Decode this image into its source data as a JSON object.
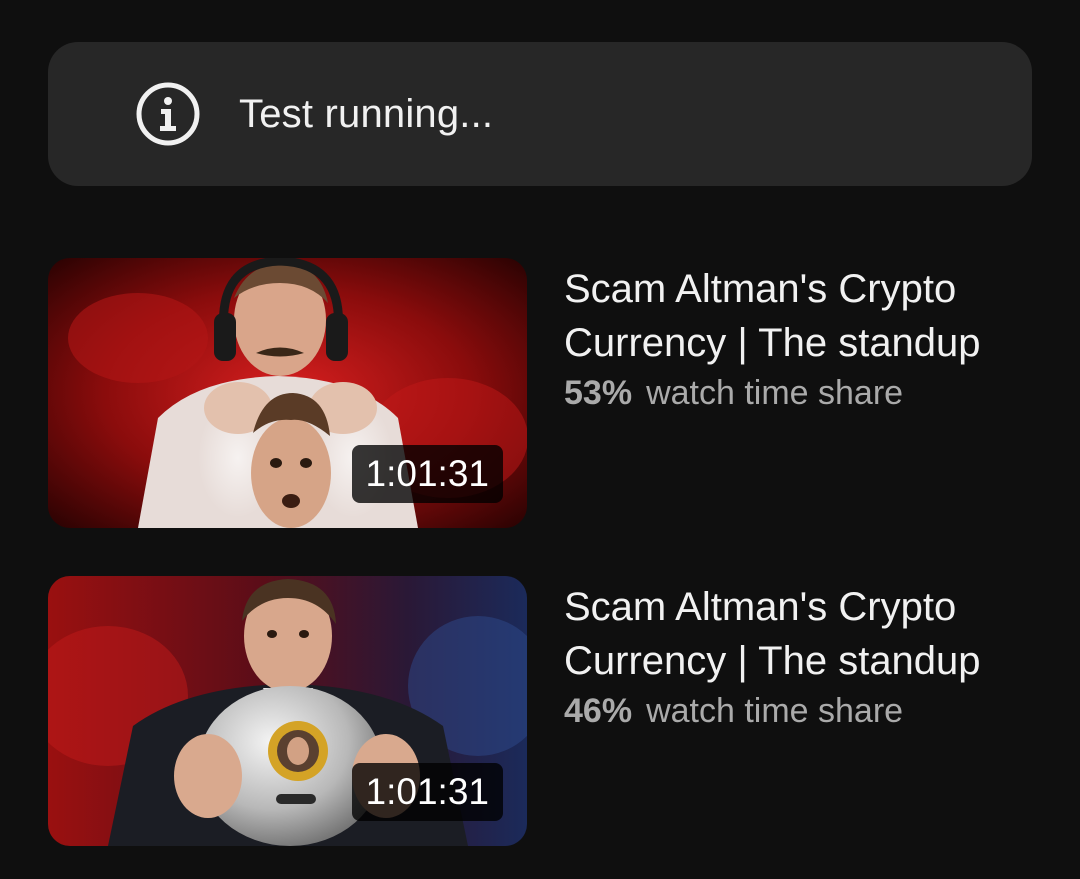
{
  "banner": {
    "icon": "info-icon",
    "text": "Test running..."
  },
  "videos": [
    {
      "title": "Scam Altman's Crypto Currency | The standup",
      "duration": "1:01:31",
      "share_value": "53%",
      "share_label": "watch time share",
      "watch_time_share": 53
    },
    {
      "title": "Scam Altman's Crypto Currency | The standup",
      "duration": "1:01:31",
      "share_value": "46%",
      "share_label": "watch time share",
      "watch_time_share": 46
    }
  ],
  "colors": {
    "background": "#0f0f0f",
    "banner_bg": "#272727",
    "text_primary": "#f1f1f1",
    "text_secondary": "#aaaaaa"
  }
}
